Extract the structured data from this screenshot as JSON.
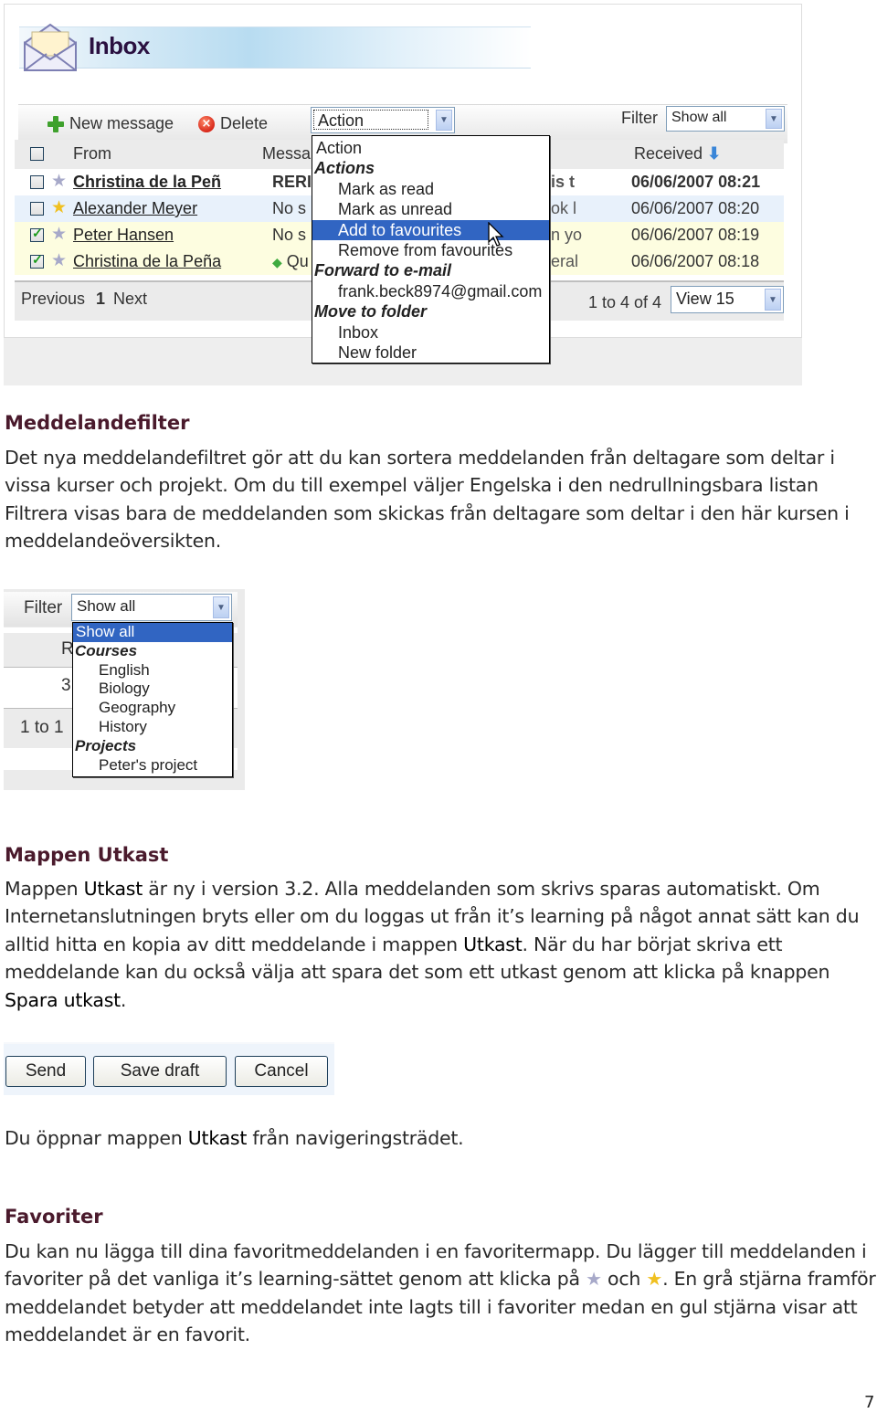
{
  "inbox_screenshot": {
    "title": "Inbox",
    "toolbar": {
      "new_message": "New message",
      "delete": "Delete",
      "action_select": "Action",
      "filter_label": "Filter",
      "filter_select": "Show all"
    },
    "columns": {
      "from": "From",
      "message": "Messa",
      "received": "Received"
    },
    "rows": [
      {
        "checked": false,
        "star": "gray",
        "from": "Christina de la Peñ",
        "message": "RERI",
        "message_tail": "is t",
        "received": "06/06/2007 08:21",
        "unread": true
      },
      {
        "checked": false,
        "star": "yellow",
        "from": "Alexander Meyer",
        "message": "No s",
        "message_tail": "ok l",
        "received": "06/06/2007 08:20",
        "unread": false
      },
      {
        "checked": true,
        "star": "gray",
        "from": "Peter Hansen",
        "message": "No s",
        "message_tail": "n yo",
        "received": "06/06/2007 08:19",
        "unread": false
      },
      {
        "checked": true,
        "star": "gray",
        "from": "Christina de la Peña",
        "message": "Qu",
        "message_tail": "eral",
        "received": "06/06/2007 08:18",
        "unread": false
      }
    ],
    "pager": {
      "previous": "Previous",
      "page": "1",
      "next": "Next",
      "count": "1 to 4 of 4",
      "view_select": "View 15"
    },
    "action_dropdown": [
      {
        "label": "Action",
        "type": "option"
      },
      {
        "label": "Actions",
        "type": "group"
      },
      {
        "label": "Mark as read",
        "type": "indent"
      },
      {
        "label": "Mark as unread",
        "type": "indent"
      },
      {
        "label": "Add to favourites",
        "type": "indent",
        "selected": true
      },
      {
        "label": "Remove from favourites",
        "type": "indent"
      },
      {
        "label": "Forward to e-mail",
        "type": "group"
      },
      {
        "label": "frank.beck8974@gmail.com",
        "type": "indent"
      },
      {
        "label": "Move to folder",
        "type": "group"
      },
      {
        "label": "Inbox",
        "type": "indent"
      },
      {
        "label": "New folder",
        "type": "indent"
      }
    ]
  },
  "section_filter": {
    "heading": "Meddelandefilter",
    "body": "Det nya meddelandefiltret gör att du kan sortera meddelanden från deltagare som deltar i vissa kurser och projekt. Om du till exempel väljer Engelska i den nedrullningsbara listan Filtrera visas bara de meddelanden som skickas från deltagare som deltar i den här kursen i meddelandeöversikten."
  },
  "filter_screenshot": {
    "filter_label": "Filter",
    "filter_select": "Show all",
    "bg_col": "R",
    "bg_cell": "3",
    "bg_count": "1 to 1",
    "dropdown": [
      {
        "label": "Show all",
        "type": "option",
        "selected": true
      },
      {
        "label": "Courses",
        "type": "group"
      },
      {
        "label": "English",
        "type": "indent"
      },
      {
        "label": "Biology",
        "type": "indent"
      },
      {
        "label": "Geography",
        "type": "indent"
      },
      {
        "label": "History",
        "type": "indent"
      },
      {
        "label": "Projects",
        "type": "group"
      },
      {
        "label": "Peter's project",
        "type": "indent"
      }
    ]
  },
  "section_drafts": {
    "heading": "Mappen Utkast",
    "p1_a": "Mappen ",
    "p1_b": "Utkast",
    "p1_c": " är ny i version 3.2. Alla meddelanden som skrivs sparas automatiskt. Om Internetanslutningen bryts eller om du loggas ut från it’s learning på något annat sätt kan du alltid hitta en kopia av ditt meddelande i mappen ",
    "p1_d": "Utkast",
    "p1_e": ". När du har börjat skriva ett meddelande kan du också välja att spara det som ett utkast genom att klicka på knappen ",
    "p1_f": "Spara utkast",
    "p1_g": ".",
    "p2_a": "Du öppnar mappen ",
    "p2_b": "Utkast",
    "p2_c": " från navigeringsträdet."
  },
  "buttons_screenshot": {
    "send": "Send",
    "save_draft": "Save draft",
    "cancel": "Cancel"
  },
  "section_favorites": {
    "heading": "Favoriter",
    "p_a": "Du kan nu lägga till dina favoritmeddelanden i en favoritermapp. Du lägger till meddelanden i favoriter på det vanliga it’s learning-sättet genom att klicka på ",
    "p_b": " och ",
    "p_c": ". En grå stjärna framför meddelandet betyder att meddelandet inte lagts till i favoriter medan en gul stjärna visar att meddelandet är en favorit."
  },
  "page_number": "7",
  "colors": {
    "heading": "#4a1a2c",
    "selection": "#3165c2",
    "unread_row": "#ffffff",
    "alt_row": "#e8f1fb",
    "checked_row": "#fdfde0",
    "star_gray": "#a7a9c9",
    "star_yellow": "#f0c020"
  }
}
